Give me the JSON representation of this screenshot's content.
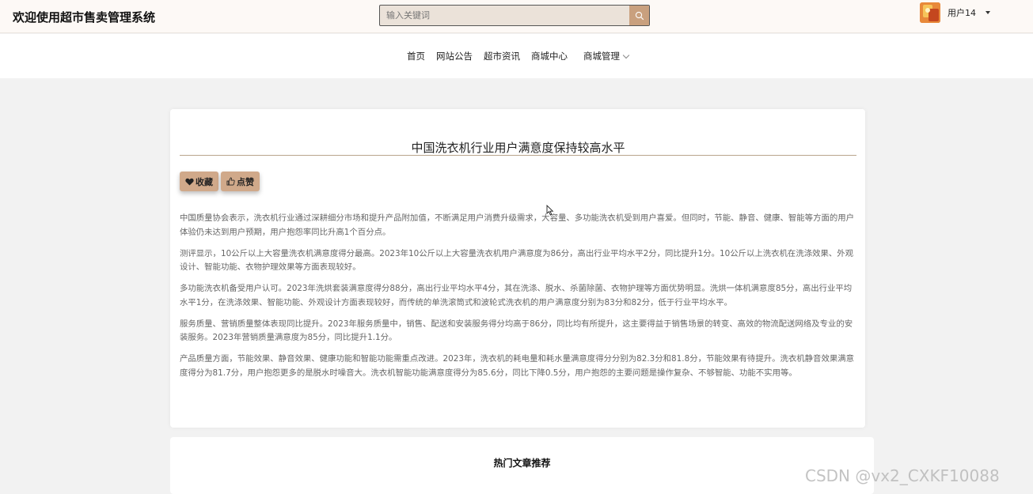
{
  "header": {
    "site_title": "欢迎使用超市售卖管理系统",
    "search_placeholder": "输入关键词",
    "user_name": "用户14"
  },
  "nav": {
    "items": [
      "首页",
      "网站公告",
      "超市资讯",
      "商城中心"
    ],
    "submenu_label": "商城管理"
  },
  "article": {
    "title": "中国洗衣机行业用户满意度保持较高水平",
    "favorite_label": "收藏",
    "like_label": "点赞",
    "paragraphs": [
      "中国质量协会表示，洗衣机行业通过深耕细分市场和提升产品附加值，不断满足用户消费升级需求，大容量、多功能洗衣机受到用户喜爱。但同时，节能、静音、健康、智能等方面的用户体验仍未达到用户预期，用户抱怨率同比升高1个百分点。",
      "测评显示，10公斤以上大容量洗衣机满意度得分最高。2023年10公斤以上大容量洗衣机用户满意度为86分，高出行业平均水平2分，同比提升1分。10公斤以上洗衣机在洗涤效果、外观设计、智能功能、衣物护理效果等方面表现较好。",
      "多功能洗衣机备受用户认可。2023年洗烘套装满意度得分88分，高出行业平均水平4分，其在洗涤、脱水、杀菌除菌、衣物护理等方面优势明显。洗烘一体机满意度85分，高出行业平均水平1分，在洗涤效果、智能功能、外观设计方面表现较好，而传统的单洗滚筒式和波轮式洗衣机的用户满意度分别为83分和82分，低于行业平均水平。",
      "服务质量、营销质量整体表现同比提升。2023年服务质量中，销售、配送和安装服务得分均高于86分，同比均有所提升，这主要得益于销售场景的转变、高效的物流配送网络及专业的安装服务。2023年营销质量满意度为85分，同比提升1.1分。",
      "产品质量方面，节能效果、静音效果、健康功能和智能功能需重点改进。2023年，洗衣机的耗电量和耗水量满意度得分分别为82.3分和81.8分，节能效果有待提升。洗衣机静音效果满意度得分为81.7分，用户抱怨更多的是脱水时噪音大。洗衣机智能功能满意度得分为85.6分，同比下降0.5分，用户抱怨的主要问题是操作复杂、不够智能、功能不实用等。"
    ]
  },
  "hot_section": {
    "title": "热门文章推荐"
  },
  "watermark": "CSDN @vx2_CXKF10088",
  "colors": {
    "accent": "#d0a98a",
    "search_bg": "#ebe2d9",
    "search_button": "#c9a07e"
  },
  "icons": {
    "search": "search-icon",
    "favorite": "heart-icon",
    "like": "thumbs-up-icon"
  }
}
